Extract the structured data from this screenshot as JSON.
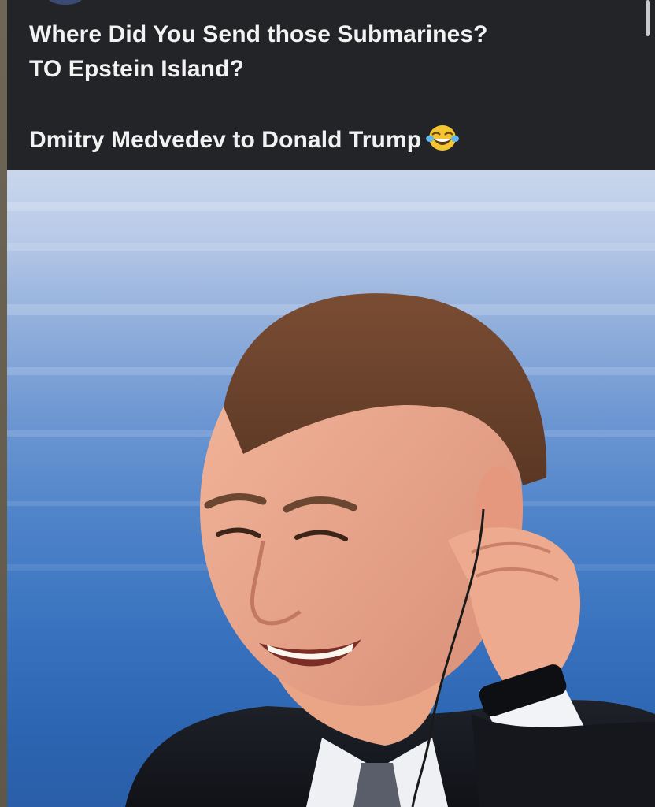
{
  "post": {
    "caption_line1": "Where Did You Send those Submarines?",
    "caption_line2": "TO Epstein Island?",
    "caption_line3": "Dmitry Medvedev to Donald Trump",
    "reaction_emoji": "face-with-tears-of-joy-icon"
  },
  "colors": {
    "header_bg": "#232427",
    "caption_text": "#f2f2f2",
    "photo_bg_top": "#c9d6ec",
    "photo_bg_bottom": "#2a5ea8"
  }
}
